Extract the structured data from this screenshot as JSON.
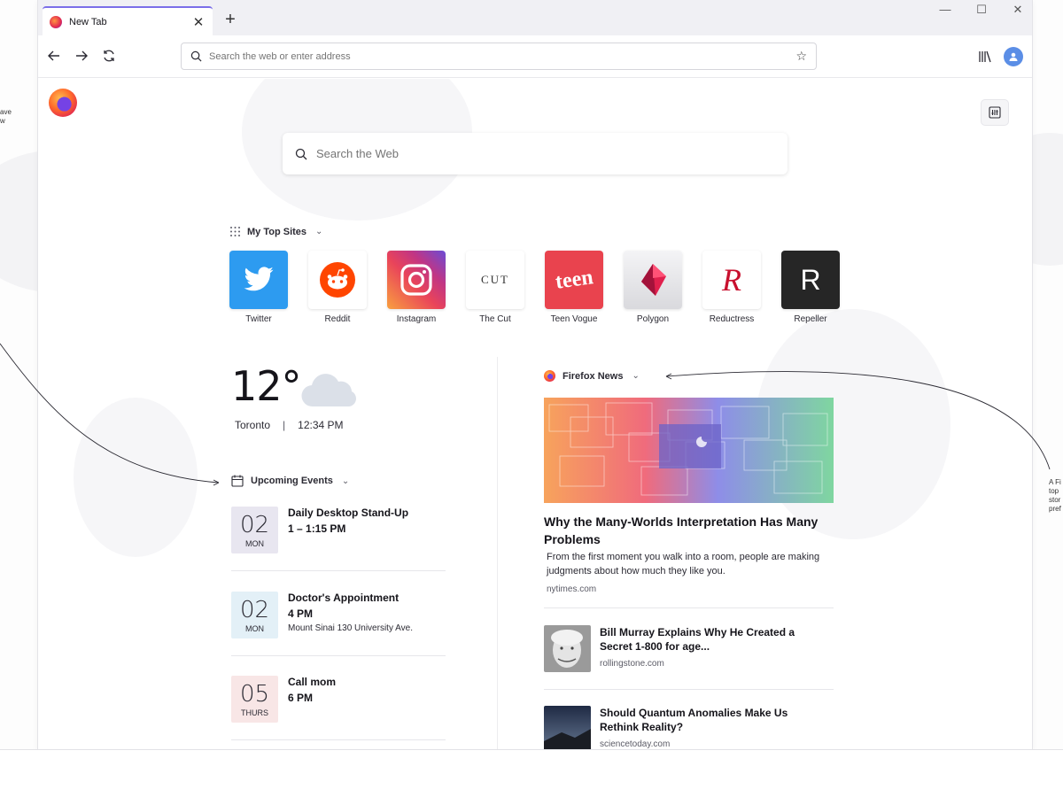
{
  "annotations": {
    "left_fragment": [
      "ave",
      "w"
    ],
    "right_fragment": [
      "A Fi",
      "top",
      "stor",
      "pref"
    ]
  },
  "browser": {
    "tab_title": "New Tab",
    "tab_close": "✕",
    "new_tab": "+",
    "window_controls": {
      "minimize": "—",
      "maximize": "☐",
      "close": "✕"
    },
    "url_placeholder": "Search the web or enter address",
    "bookmark_star": "☆"
  },
  "newtab": {
    "search_placeholder": "Search the Web",
    "top_sites_heading": "My Top Sites",
    "chevron": "⌄",
    "top_sites": [
      {
        "label": "Twitter",
        "bg": "#2d9bf0",
        "icon": "twitter-bird"
      },
      {
        "label": "Reddit",
        "bg": "#ffffff",
        "icon": "reddit-alien"
      },
      {
        "label": "Instagram",
        "bg": "#d6249f",
        "icon": "instagram-camera"
      },
      {
        "label": "The Cut",
        "bg": "#ffffff",
        "icon": "the-cut-wordmark",
        "text": "CUT"
      },
      {
        "label": "Teen Vogue",
        "bg": "#e9434e",
        "icon": "teen-vogue-wordmark",
        "text": "teen"
      },
      {
        "label": "Polygon",
        "bg": "#ececee",
        "icon": "polygon-logo"
      },
      {
        "label": "Reductress",
        "bg": "#ffffff",
        "icon": "reductress-logo",
        "text": "R"
      },
      {
        "label": "Repeller",
        "bg": "#2b2b2b",
        "icon": "repeller-logo",
        "text": "R"
      }
    ],
    "weather": {
      "temperature": "12°",
      "city": "Toronto",
      "separator": "|",
      "time": "12:34 PM"
    },
    "events_heading": "Upcoming Events",
    "events": [
      {
        "day": "02",
        "dow": "MON",
        "title": "Daily Desktop Stand-Up",
        "time": "1 – 1:15 PM",
        "location": "",
        "color": "#e8e6f0"
      },
      {
        "day": "02",
        "dow": "MON",
        "title": "Doctor's Appointment",
        "time": "4 PM",
        "location": "Mount Sinai 130 University Ave.",
        "color": "#e3f0f7"
      },
      {
        "day": "05",
        "dow": "THURS",
        "title": "Call mom",
        "time": "6 PM",
        "location": "",
        "color": "#f8e6e6"
      }
    ],
    "news_heading": "Firefox News",
    "featured": {
      "title": "Why the Many-Worlds Interpretation Has Many Problems",
      "description": "From the first moment you walk into a room, people are making judgments about how much they like you.",
      "source": "nytimes.com"
    },
    "stories": [
      {
        "title": "Bill Murray Explains Why He Created a Secret 1-800 for age...",
        "source": "rollingstone.com"
      },
      {
        "title": "Should Quantum Anomalies Make Us Rethink Reality?",
        "source": "sciencetoday.com"
      }
    ]
  }
}
